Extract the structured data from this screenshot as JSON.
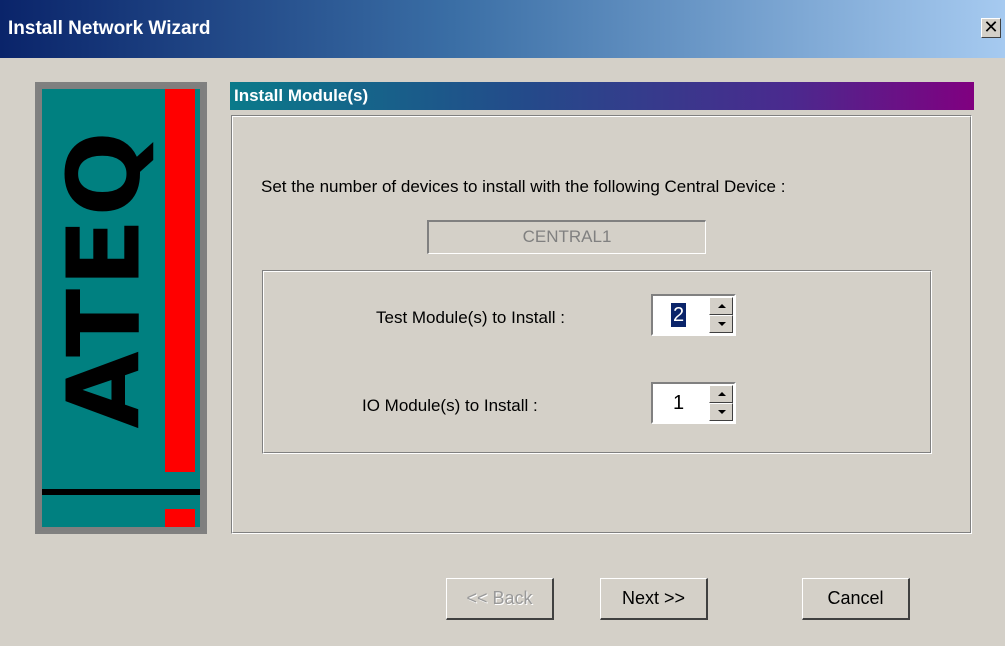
{
  "window": {
    "title": "Install Network Wizard",
    "close_glyph": "✕"
  },
  "logo": {
    "text": "ATEQ",
    "colors": {
      "background": "#008080",
      "accent": "#ff0000",
      "text": "#000000"
    }
  },
  "section": {
    "title": "Install Module(s)"
  },
  "main": {
    "instruction": "Set the number of devices to install with the following Central Device :",
    "central_device": "CENTRAL1",
    "test_modules": {
      "label": "Test Module(s) to Install :",
      "value": "2"
    },
    "io_modules": {
      "label": "IO Module(s) to Install :",
      "value": "1"
    }
  },
  "buttons": {
    "back": "<< Back",
    "next": "Next >>",
    "cancel": "Cancel"
  }
}
